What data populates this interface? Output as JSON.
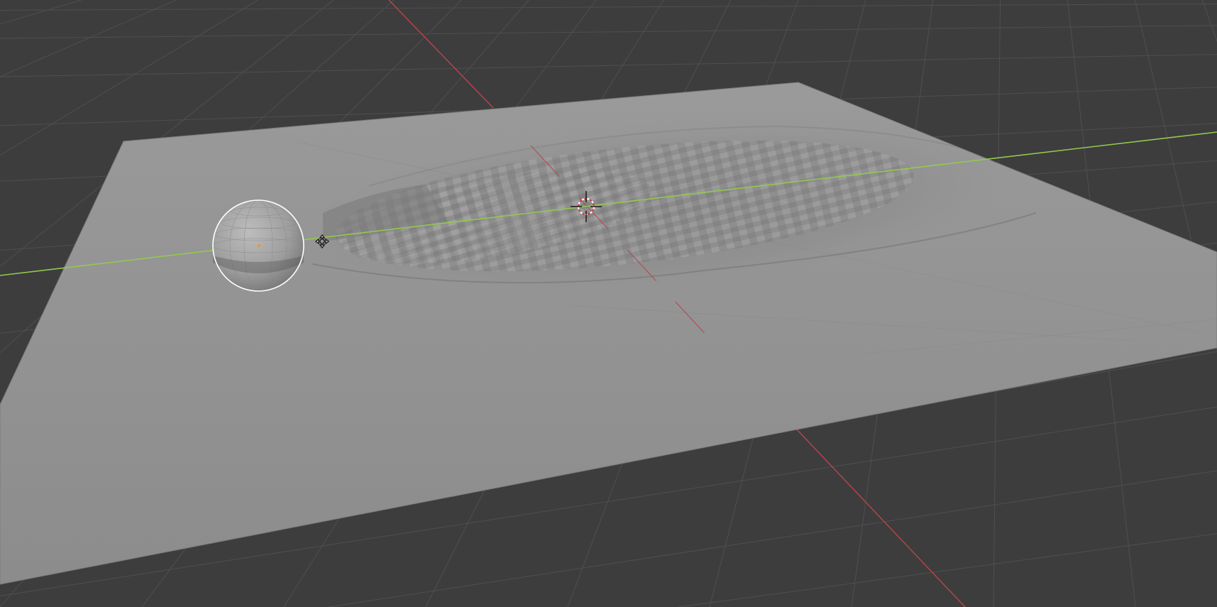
{
  "viewport": {
    "background_color": "#3d3d3d",
    "grid_color": "#4e4e4e",
    "x_axis_color": "#b8454d",
    "y_axis_color": "#93c94f",
    "plane_color": "#939393",
    "sphere_color": "#a3a3a3",
    "selection_outline_color": "#ffffff"
  },
  "icons": {
    "cursor": "3d-cursor-icon",
    "gizmo": "move-gizmo-icon",
    "origin": "object-origin-icon"
  }
}
